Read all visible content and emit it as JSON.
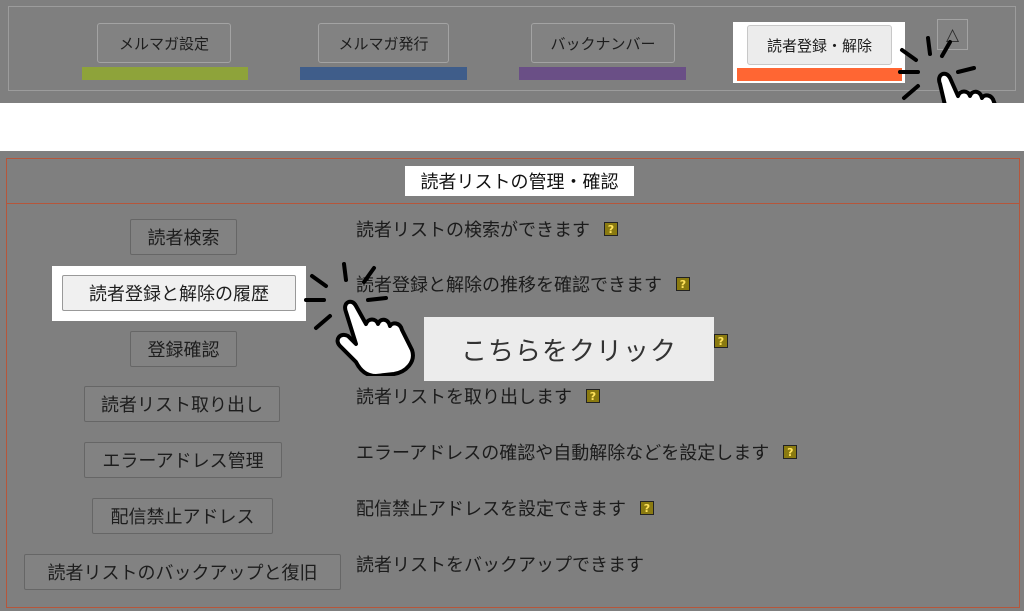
{
  "header": {
    "tabs": [
      {
        "label": "メルマガ設定",
        "stripe_color": "#8ea33a"
      },
      {
        "label": "メルマガ発行",
        "stripe_color": "#3f5d8a"
      },
      {
        "label": "バックナンバー",
        "stripe_color": "#6a4f86"
      },
      {
        "label": "読者登録・解除",
        "stripe_color": "#ff6633"
      }
    ],
    "scroll_icon": "triangle-up"
  },
  "panel": {
    "title": "読者リストの管理・確認",
    "rows": [
      {
        "button": "読者検索",
        "description": "読者リストの検索ができます",
        "help": "?"
      },
      {
        "button": "読者登録と解除の履歴",
        "description": "読者登録と解除の推移を確認できます",
        "help": "?"
      },
      {
        "button": "登録確認",
        "description": "",
        "help": "?"
      },
      {
        "button": "読者リスト取り出し",
        "description": "読者リストを取り出します",
        "help": "?"
      },
      {
        "button": "エラーアドレス管理",
        "description": "エラーアドレスの確認や自動解除などを設定します",
        "help": "?"
      },
      {
        "button": "配信禁止アドレス",
        "description": "配信禁止アドレスを設定できます",
        "help": "?"
      },
      {
        "button": "読者リストのバックアップと復旧",
        "description": "読者リストをバックアップできます",
        "help": ""
      }
    ]
  },
  "annotation": {
    "tooltip": "こちらをクリック",
    "cursor_icon": "pointing-hand-click"
  }
}
